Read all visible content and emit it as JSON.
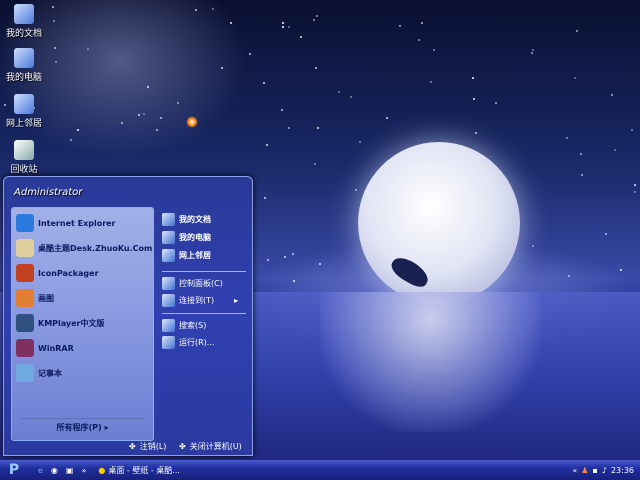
{
  "desktop_icons": [
    {
      "label": "我的文档"
    },
    {
      "label": "我的电脑"
    },
    {
      "label": "网上邻居"
    },
    {
      "label": "回收站"
    }
  ],
  "start_menu": {
    "user": "Administrator",
    "programs": [
      {
        "label": "Internet Explorer",
        "icon": "ie-icon",
        "color": "#2a7ae0"
      },
      {
        "label": "桌酷主题Desk.ZhuoKu.Com",
        "icon": "zhuoku-icon",
        "color": "#e0d0a0"
      },
      {
        "label": "IconPackager",
        "icon": "iconpackager-icon",
        "color": "#c04020"
      },
      {
        "label": "画图",
        "icon": "paint-icon",
        "color": "#e08030"
      },
      {
        "label": "KMPlayer中文版",
        "icon": "kmplayer-icon",
        "color": "#305080"
      },
      {
        "label": "WinRAR",
        "icon": "winrar-icon",
        "color": "#803060"
      },
      {
        "label": "记事本",
        "icon": "notepad-icon",
        "color": "#70a8e0"
      }
    ],
    "all_programs": "所有程序(P)",
    "places": [
      {
        "label": "我的文档",
        "bold": true
      },
      {
        "label": "我的电脑",
        "bold": true
      },
      {
        "label": "网上邻居",
        "bold": true
      },
      {
        "label": "控制面板(C)"
      },
      {
        "label": "连接到(T)",
        "arrow": "▸"
      },
      {
        "label": "搜索(S)"
      },
      {
        "label": "运行(R)..."
      }
    ],
    "logoff": "注销(L)",
    "shutdown": "关闭计算机(U)"
  },
  "taskbar": {
    "task": "桌面 - 壁纸 - 桌酷...",
    "clock": "23:36",
    "chevron": "»",
    "tray_chevron": "«"
  }
}
